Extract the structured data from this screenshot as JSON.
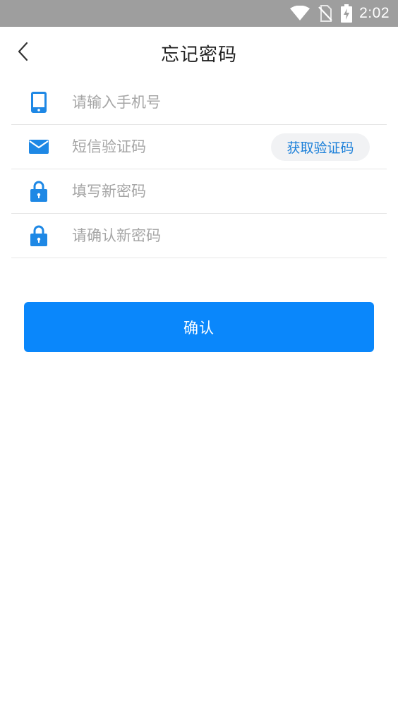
{
  "status_bar": {
    "time": "2:02",
    "icons": [
      "wifi-icon",
      "no-sim-icon",
      "battery-charging-icon"
    ]
  },
  "header": {
    "title": "忘记密码",
    "back_icon": "chevron-left-icon"
  },
  "form": {
    "phone": {
      "placeholder": "请输入手机号",
      "value": "",
      "icon": "phone-icon"
    },
    "sms_code": {
      "placeholder": "短信验证码",
      "value": "",
      "icon": "envelope-icon",
      "button_label": "获取验证码"
    },
    "new_password": {
      "placeholder": "填写新密码",
      "value": "",
      "icon": "lock-icon"
    },
    "confirm_password": {
      "placeholder": "请确认新密码",
      "value": "",
      "icon": "lock-icon"
    }
  },
  "actions": {
    "confirm_label": "确认"
  },
  "colors": {
    "accent": "#0a87fb",
    "icon_blue": "#1e88e5",
    "status_bar": "#9e9e9e",
    "divider": "#e6e6e6",
    "placeholder": "#a6a6a6"
  }
}
